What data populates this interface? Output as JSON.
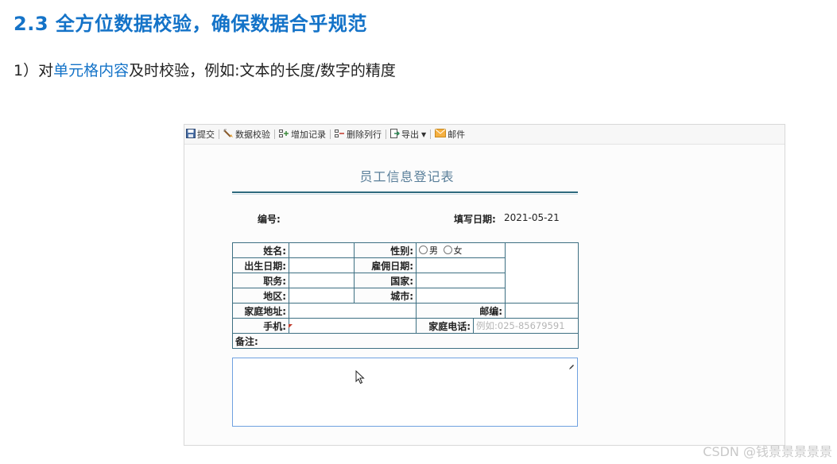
{
  "slide": {
    "heading": "2.3 全方位数据校验，确保数据合乎规范",
    "point_prefix": "1）对",
    "point_highlight": "单元格内容",
    "point_suffix": "及时校验，例如:文本的长度/数字的精度"
  },
  "toolbar": {
    "submit": "提交",
    "validate": "数据校验",
    "add_record": "增加记录",
    "delete_row": "删除列行",
    "export": "导出",
    "mail": "邮件"
  },
  "form": {
    "title": "员工信息登记表",
    "id_label": "编号:",
    "date_label": "填写日期:",
    "date_value": "2021-05-21",
    "name_label": "姓名:",
    "gender_label": "性别:",
    "gender_male": "男",
    "gender_female": "女",
    "birth_label": "出生日期:",
    "hire_label": "雇佣日期:",
    "position_label": "职务:",
    "country_label": "国家:",
    "region_label": "地区:",
    "city_label": "城市:",
    "address_label": "家庭地址:",
    "zip_label": "邮编:",
    "mobile_label": "手机:",
    "home_phone_label": "家庭电话:",
    "home_phone_placeholder": "例如:025-85679591",
    "note_label": "备注:"
  },
  "watermark": "CSDN @钱景景景景景"
}
